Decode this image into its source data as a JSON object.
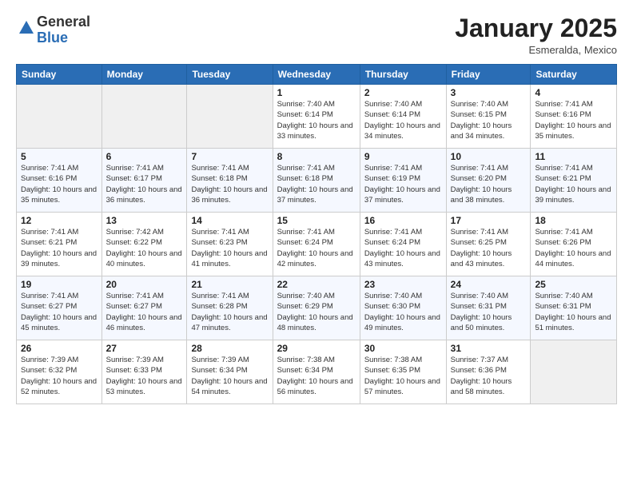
{
  "header": {
    "logo_general": "General",
    "logo_blue": "Blue",
    "month_title": "January 2025",
    "location": "Esmeralda, Mexico"
  },
  "days_of_week": [
    "Sunday",
    "Monday",
    "Tuesday",
    "Wednesday",
    "Thursday",
    "Friday",
    "Saturday"
  ],
  "weeks": [
    [
      {
        "day": "",
        "info": ""
      },
      {
        "day": "",
        "info": ""
      },
      {
        "day": "",
        "info": ""
      },
      {
        "day": "1",
        "info": "Sunrise: 7:40 AM\nSunset: 6:14 PM\nDaylight: 10 hours\nand 33 minutes."
      },
      {
        "day": "2",
        "info": "Sunrise: 7:40 AM\nSunset: 6:14 PM\nDaylight: 10 hours\nand 34 minutes."
      },
      {
        "day": "3",
        "info": "Sunrise: 7:40 AM\nSunset: 6:15 PM\nDaylight: 10 hours\nand 34 minutes."
      },
      {
        "day": "4",
        "info": "Sunrise: 7:41 AM\nSunset: 6:16 PM\nDaylight: 10 hours\nand 35 minutes."
      }
    ],
    [
      {
        "day": "5",
        "info": "Sunrise: 7:41 AM\nSunset: 6:16 PM\nDaylight: 10 hours\nand 35 minutes."
      },
      {
        "day": "6",
        "info": "Sunrise: 7:41 AM\nSunset: 6:17 PM\nDaylight: 10 hours\nand 36 minutes."
      },
      {
        "day": "7",
        "info": "Sunrise: 7:41 AM\nSunset: 6:18 PM\nDaylight: 10 hours\nand 36 minutes."
      },
      {
        "day": "8",
        "info": "Sunrise: 7:41 AM\nSunset: 6:18 PM\nDaylight: 10 hours\nand 37 minutes."
      },
      {
        "day": "9",
        "info": "Sunrise: 7:41 AM\nSunset: 6:19 PM\nDaylight: 10 hours\nand 37 minutes."
      },
      {
        "day": "10",
        "info": "Sunrise: 7:41 AM\nSunset: 6:20 PM\nDaylight: 10 hours\nand 38 minutes."
      },
      {
        "day": "11",
        "info": "Sunrise: 7:41 AM\nSunset: 6:21 PM\nDaylight: 10 hours\nand 39 minutes."
      }
    ],
    [
      {
        "day": "12",
        "info": "Sunrise: 7:41 AM\nSunset: 6:21 PM\nDaylight: 10 hours\nand 39 minutes."
      },
      {
        "day": "13",
        "info": "Sunrise: 7:42 AM\nSunset: 6:22 PM\nDaylight: 10 hours\nand 40 minutes."
      },
      {
        "day": "14",
        "info": "Sunrise: 7:41 AM\nSunset: 6:23 PM\nDaylight: 10 hours\nand 41 minutes."
      },
      {
        "day": "15",
        "info": "Sunrise: 7:41 AM\nSunset: 6:24 PM\nDaylight: 10 hours\nand 42 minutes."
      },
      {
        "day": "16",
        "info": "Sunrise: 7:41 AM\nSunset: 6:24 PM\nDaylight: 10 hours\nand 43 minutes."
      },
      {
        "day": "17",
        "info": "Sunrise: 7:41 AM\nSunset: 6:25 PM\nDaylight: 10 hours\nand 43 minutes."
      },
      {
        "day": "18",
        "info": "Sunrise: 7:41 AM\nSunset: 6:26 PM\nDaylight: 10 hours\nand 44 minutes."
      }
    ],
    [
      {
        "day": "19",
        "info": "Sunrise: 7:41 AM\nSunset: 6:27 PM\nDaylight: 10 hours\nand 45 minutes."
      },
      {
        "day": "20",
        "info": "Sunrise: 7:41 AM\nSunset: 6:27 PM\nDaylight: 10 hours\nand 46 minutes."
      },
      {
        "day": "21",
        "info": "Sunrise: 7:41 AM\nSunset: 6:28 PM\nDaylight: 10 hours\nand 47 minutes."
      },
      {
        "day": "22",
        "info": "Sunrise: 7:40 AM\nSunset: 6:29 PM\nDaylight: 10 hours\nand 48 minutes."
      },
      {
        "day": "23",
        "info": "Sunrise: 7:40 AM\nSunset: 6:30 PM\nDaylight: 10 hours\nand 49 minutes."
      },
      {
        "day": "24",
        "info": "Sunrise: 7:40 AM\nSunset: 6:31 PM\nDaylight: 10 hours\nand 50 minutes."
      },
      {
        "day": "25",
        "info": "Sunrise: 7:40 AM\nSunset: 6:31 PM\nDaylight: 10 hours\nand 51 minutes."
      }
    ],
    [
      {
        "day": "26",
        "info": "Sunrise: 7:39 AM\nSunset: 6:32 PM\nDaylight: 10 hours\nand 52 minutes."
      },
      {
        "day": "27",
        "info": "Sunrise: 7:39 AM\nSunset: 6:33 PM\nDaylight: 10 hours\nand 53 minutes."
      },
      {
        "day": "28",
        "info": "Sunrise: 7:39 AM\nSunset: 6:34 PM\nDaylight: 10 hours\nand 54 minutes."
      },
      {
        "day": "29",
        "info": "Sunrise: 7:38 AM\nSunset: 6:34 PM\nDaylight: 10 hours\nand 56 minutes."
      },
      {
        "day": "30",
        "info": "Sunrise: 7:38 AM\nSunset: 6:35 PM\nDaylight: 10 hours\nand 57 minutes."
      },
      {
        "day": "31",
        "info": "Sunrise: 7:37 AM\nSunset: 6:36 PM\nDaylight: 10 hours\nand 58 minutes."
      },
      {
        "day": "",
        "info": ""
      }
    ]
  ]
}
